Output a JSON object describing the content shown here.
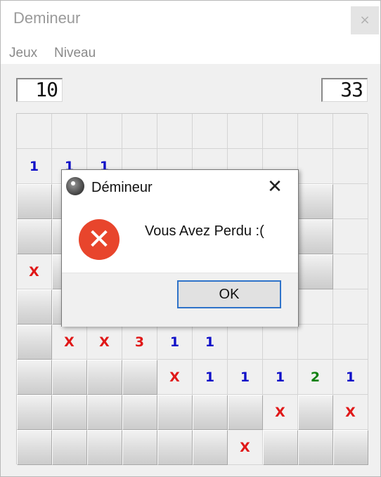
{
  "window": {
    "title": "Demineur",
    "close_glyph": "×"
  },
  "menu": [
    {
      "label": "Jeux"
    },
    {
      "label": "Niveau"
    }
  ],
  "counters": {
    "mines_left": "10",
    "timer": "33"
  },
  "board": {
    "rows": [
      [
        "o",
        "o",
        "o",
        "o",
        "o",
        "o",
        "o",
        "o",
        "o",
        "o"
      ],
      [
        "1",
        "1",
        "1",
        "o",
        "o",
        "o",
        "o",
        "o",
        "o",
        "o"
      ],
      [
        "c",
        "c",
        "c",
        "c",
        "c",
        "c",
        "c",
        "c",
        "c",
        "o"
      ],
      [
        "c",
        "c",
        "c",
        "c",
        "c",
        "c",
        "c",
        "c",
        "c",
        "o"
      ],
      [
        "X",
        "c",
        "c",
        "c",
        "c",
        "c",
        "c",
        "c",
        "c",
        "o"
      ],
      [
        "c",
        "c",
        "c",
        "c",
        "c",
        "c",
        "c",
        "o",
        "o",
        "o"
      ],
      [
        "c",
        "X",
        "X",
        "3",
        "1",
        "1",
        "o",
        "o",
        "o",
        "o"
      ],
      [
        "c",
        "c",
        "c",
        "c",
        "X",
        "1",
        "1",
        "1",
        "2",
        "1"
      ],
      [
        "c",
        "c",
        "c",
        "c",
        "c",
        "c",
        "c",
        "X",
        "c",
        "X"
      ],
      [
        "c",
        "c",
        "c",
        "c",
        "c",
        "c",
        "X",
        "c",
        "c",
        "c"
      ]
    ],
    "legend": {
      "o": "revealed-empty",
      "c": "covered",
      "X": "revealed-mine",
      "1": "number",
      "2": "number",
      "3": "number"
    }
  },
  "dialog": {
    "title": "Démineur",
    "message": "Vous Avez Perdu :(",
    "ok_label": "OK",
    "close_glyph": "✕",
    "error_glyph": "✕",
    "icon": "minesweeper-app-icon"
  },
  "colors": {
    "number_1": "#1010c8",
    "number_2": "#108010",
    "number_3": "#e01818",
    "mine_x": "#e01818",
    "error_icon": "#e8452c",
    "ok_button_border": "#2f73c9"
  }
}
